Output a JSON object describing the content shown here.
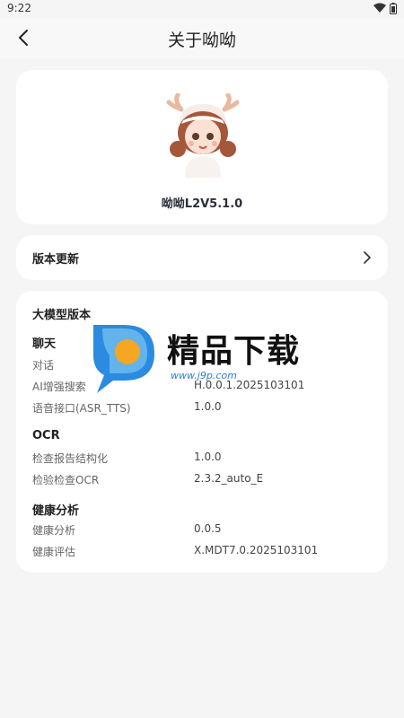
{
  "status_bar": {
    "time": "9:22",
    "icons": [
      "wifi-icon",
      "battery-icon"
    ]
  },
  "header": {
    "title": "关于呦呦",
    "back_icon": "back-arrow-icon"
  },
  "profile": {
    "model_name": "呦呦L2V5.1.0"
  },
  "update": {
    "label": "版本更新"
  },
  "versions": {
    "title": "大模型版本",
    "groups": [
      {
        "title": "聊天",
        "rows": [
          {
            "label": "对话",
            "value": ""
          },
          {
            "label": "AI增强搜索",
            "value": "H.0.0.1.2025103101"
          },
          {
            "label": "语音接口(ASR_TTS)",
            "value": "1.0.0"
          }
        ]
      },
      {
        "title": "OCR",
        "rows": [
          {
            "label": "检查报告结构化",
            "value": "1.0.0"
          },
          {
            "label": "检验检查OCR",
            "value": "2.3.2_auto_E"
          }
        ]
      },
      {
        "title": "健康分析",
        "rows": [
          {
            "label": "健康分析",
            "value": "0.0.5"
          },
          {
            "label": "健康评估",
            "value": "X.MDT7.0.2025103101"
          }
        ]
      }
    ]
  },
  "watermark": {
    "text": "精品下载",
    "url": "www.j9p.com"
  },
  "colors": {
    "background": "#f4f5f4",
    "card": "#ffffff",
    "watermark_blue": "#2a7dd6",
    "watermark_orange": "#f5a623"
  }
}
